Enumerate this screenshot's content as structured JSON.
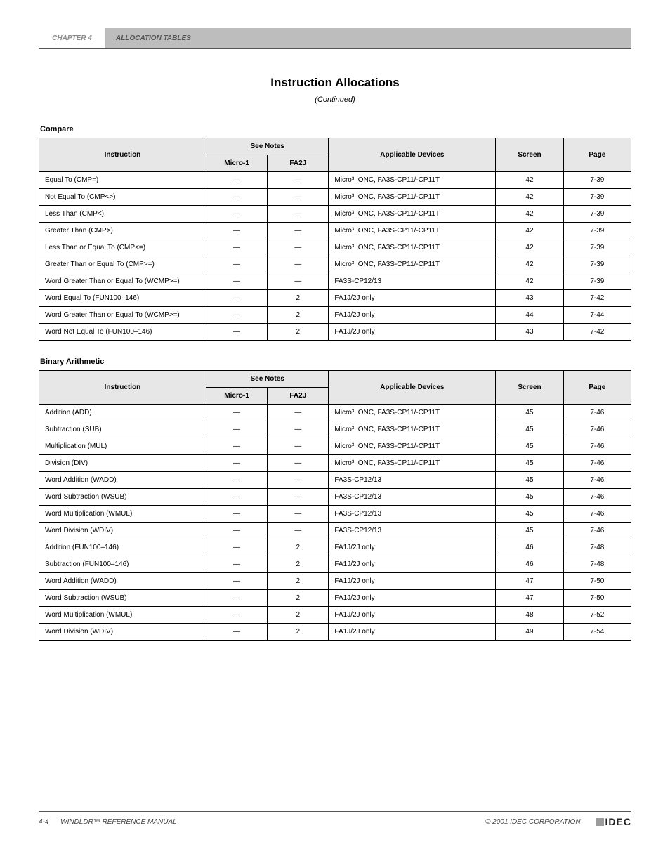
{
  "header": {
    "chapter": "CHAPTER 4",
    "title": "ALLOCATION TABLES",
    "section": "Instruction Allocations",
    "subtitle": "(Continued)"
  },
  "tables": [
    {
      "label": "Compare",
      "headers": {
        "instruction": "Instruction",
        "notes": "See Notes",
        "dev": "Applicable Devices",
        "screen": "Screen",
        "page": "Page"
      },
      "subheaders": {
        "micro1": "Micro-1",
        "fa2j": "FA2J"
      },
      "rows": [
        {
          "i": "Equal To (CMP=)",
          "n1": "—",
          "n2": "—",
          "dev": "Micro³, ONC, FA3S-CP11/-CP11T",
          "s": "42",
          "p": "7-39"
        },
        {
          "i": "Not Equal To (CMP<>)",
          "n1": "—",
          "n2": "—",
          "dev": "Micro³, ONC, FA3S-CP11/-CP11T",
          "s": "42",
          "p": "7-39"
        },
        {
          "i": "Less Than (CMP<)",
          "n1": "—",
          "n2": "—",
          "dev": "Micro³, ONC, FA3S-CP11/-CP11T",
          "s": "42",
          "p": "7-39"
        },
        {
          "i": "Greater Than (CMP>)",
          "n1": "—",
          "n2": "—",
          "dev": "Micro³, ONC, FA3S-CP11/-CP11T",
          "s": "42",
          "p": "7-39"
        },
        {
          "i": "Less Than or Equal To (CMP<=)",
          "n1": "—",
          "n2": "—",
          "dev": "Micro³, ONC, FA3S-CP11/-CP11T",
          "s": "42",
          "p": "7-39"
        },
        {
          "i": "Greater Than or Equal To (CMP>=)",
          "n1": "—",
          "n2": "—",
          "dev": "Micro³, ONC, FA3S-CP11/-CP11T",
          "s": "42",
          "p": "7-39"
        },
        {
          "i": "Word Greater Than or Equal To (WCMP>=)",
          "n1": "—",
          "n2": "—",
          "dev": "FA3S-CP12/13",
          "s": "42",
          "p": "7-39"
        },
        {
          "i": "Word Equal To (FUN100–146)",
          "n1": "—",
          "n2": "2",
          "dev": "FA1J/2J only",
          "s": "43",
          "p": "7-42"
        },
        {
          "i": "Word Greater Than or Equal To (WCMP>=)",
          "n1": "—",
          "n2": "2",
          "dev": "FA1J/2J only",
          "s": "44",
          "p": "7-44"
        },
        {
          "i": "Word Not Equal To (FUN100–146)",
          "n1": "—",
          "n2": "2",
          "dev": "FA1J/2J only",
          "s": "43",
          "p": "7-42"
        }
      ]
    },
    {
      "label": "Binary Arithmetic",
      "headers": {
        "instruction": "Instruction",
        "notes": "See Notes",
        "dev": "Applicable Devices",
        "screen": "Screen",
        "page": "Page"
      },
      "subheaders": {
        "micro1": "Micro-1",
        "fa2j": "FA2J"
      },
      "rows": [
        {
          "i": "Addition (ADD)",
          "n1": "—",
          "n2": "—",
          "dev": "Micro³, ONC, FA3S-CP11/-CP11T",
          "s": "45",
          "p": "7-46"
        },
        {
          "i": "Subtraction (SUB)",
          "n1": "—",
          "n2": "—",
          "dev": "Micro³, ONC, FA3S-CP11/-CP11T",
          "s": "45",
          "p": "7-46"
        },
        {
          "i": "Multiplication (MUL)",
          "n1": "—",
          "n2": "—",
          "dev": "Micro³, ONC, FA3S-CP11/-CP11T",
          "s": "45",
          "p": "7-46"
        },
        {
          "i": "Division (DIV)",
          "n1": "—",
          "n2": "—",
          "dev": "Micro³, ONC, FA3S-CP11/-CP11T",
          "s": "45",
          "p": "7-46"
        },
        {
          "i": "Word Addition (WADD)",
          "n1": "—",
          "n2": "—",
          "dev": "FA3S-CP12/13",
          "s": "45",
          "p": "7-46"
        },
        {
          "i": "Word Subtraction (WSUB)",
          "n1": "—",
          "n2": "—",
          "dev": "FA3S-CP12/13",
          "s": "45",
          "p": "7-46"
        },
        {
          "i": "Word Multiplication (WMUL)",
          "n1": "—",
          "n2": "—",
          "dev": "FA3S-CP12/13",
          "s": "45",
          "p": "7-46"
        },
        {
          "i": "Word Division (WDIV)",
          "n1": "—",
          "n2": "—",
          "dev": "FA3S-CP12/13",
          "s": "45",
          "p": "7-46"
        },
        {
          "i": "Addition (FUN100–146)",
          "n1": "—",
          "n2": "2",
          "dev": "FA1J/2J only",
          "s": "46",
          "p": "7-48"
        },
        {
          "i": "Subtraction (FUN100–146)",
          "n1": "—",
          "n2": "2",
          "dev": "FA1J/2J only",
          "s": "46",
          "p": "7-48"
        },
        {
          "i": "Word Addition (WADD)",
          "n1": "—",
          "n2": "2",
          "dev": "FA1J/2J only",
          "s": "47",
          "p": "7-50"
        },
        {
          "i": "Word Subtraction (WSUB)",
          "n1": "—",
          "n2": "2",
          "dev": "FA1J/2J only",
          "s": "47",
          "p": "7-50"
        },
        {
          "i": "Word Multiplication (WMUL)",
          "n1": "—",
          "n2": "2",
          "dev": "FA1J/2J only",
          "s": "48",
          "p": "7-52"
        },
        {
          "i": "Word Division (WDIV)",
          "n1": "—",
          "n2": "2",
          "dev": "FA1J/2J only",
          "s": "49",
          "p": "7-54"
        }
      ]
    }
  ],
  "footer": {
    "pageLabel": "4-4",
    "manual": "WINDLDR™ REFERENCE MANUAL",
    "docNote": "© 2001 IDEC CORPORATION",
    "logoText": "IDEC"
  }
}
